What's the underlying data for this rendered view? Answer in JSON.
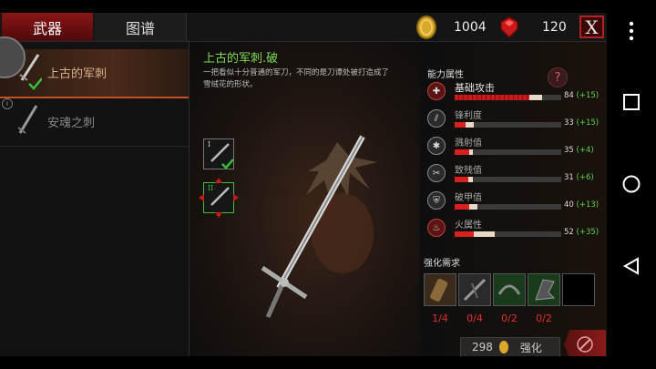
{
  "tabs": [
    {
      "label": "武器",
      "active": true
    },
    {
      "label": "图谱",
      "active": false
    }
  ],
  "currency": {
    "gold": "1004",
    "gems": "120"
  },
  "close_label": "X",
  "weapons": [
    {
      "name": "上古的军刺",
      "selected": true
    },
    {
      "name": "安魂之刺",
      "selected": false
    }
  ],
  "weapon": {
    "title": "上古的军刺.破",
    "description": "一把看似十分普通的军刀，不同的是刀谭处被打造成了雪绒花的形状。"
  },
  "tiers": [
    {
      "label": "I",
      "status": "complete"
    },
    {
      "label": "II",
      "status": "selected"
    }
  ],
  "attributes_title": "能力属性",
  "stats": [
    {
      "name": "基础攻击",
      "value": "84",
      "bonus": "(+15)",
      "ratio": 0.7,
      "bonus_ratio": 0.12,
      "icon": "attack-icon"
    },
    {
      "name": "锋利度",
      "value": "33",
      "bonus": "(+15)",
      "ratio": 0.1,
      "bonus_ratio": 0.08,
      "icon": "sharpness-icon"
    },
    {
      "name": "溅射值",
      "value": "35",
      "bonus": "(+4)",
      "ratio": 0.14,
      "bonus_ratio": 0.03,
      "icon": "splash-icon"
    },
    {
      "name": "致残值",
      "value": "31",
      "bonus": "(+6)",
      "ratio": 0.13,
      "bonus_ratio": 0.04,
      "icon": "cripple-icon"
    },
    {
      "name": "破甲值",
      "value": "40",
      "bonus": "(+13)",
      "ratio": 0.14,
      "bonus_ratio": 0.07,
      "icon": "armor-break-icon"
    },
    {
      "name": "火属性",
      "value": "52",
      "bonus": "(+35)",
      "ratio": 0.18,
      "bonus_ratio": 0.2,
      "icon": "fire-icon"
    }
  ],
  "requirements_title": "强化需求",
  "materials": [
    {
      "count": "1/4"
    },
    {
      "count": "0/4"
    },
    {
      "count": "0/2"
    },
    {
      "count": "0/2"
    }
  ],
  "upgrade": {
    "cost": "298",
    "label": "强化"
  },
  "colors": {
    "accent": "#8a1515",
    "bonus": "#5fd24a",
    "shortage": "#e03030",
    "weapon_name": "#7ed957"
  }
}
